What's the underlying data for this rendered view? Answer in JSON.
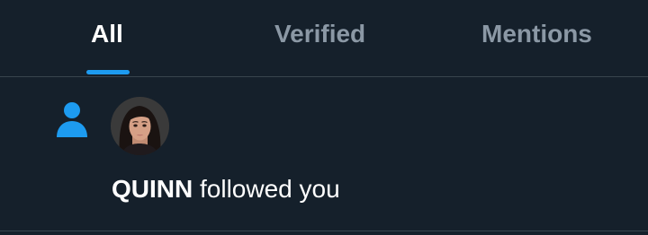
{
  "tabs": {
    "items": [
      {
        "label": "All"
      },
      {
        "label": "Verified"
      },
      {
        "label": "Mentions"
      }
    ],
    "active": "All"
  },
  "notification": {
    "icon": "person-icon",
    "username": "QUINN",
    "action": " followed you"
  },
  "colors": {
    "background": "#15202b",
    "accent": "#1d9bf0",
    "text_primary": "#ffffff",
    "text_secondary": "#8b98a5",
    "divider": "#38444d"
  }
}
